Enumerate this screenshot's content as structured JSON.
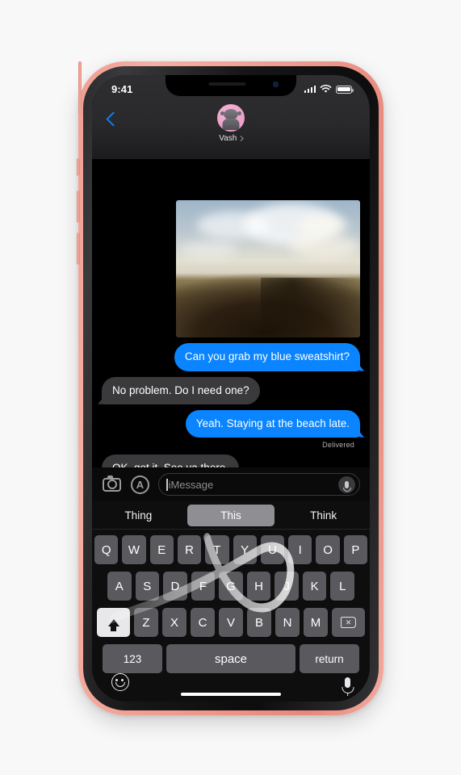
{
  "device": {
    "name": "iPhone XR",
    "frame_color": "#ef9b8f",
    "screen_background": "#000000"
  },
  "status_bar": {
    "time": "9:41",
    "signal_icon": "cellular-bars-icon",
    "wifi_icon": "wifi-icon",
    "battery_icon": "battery-full-icon"
  },
  "nav_bar": {
    "back_icon": "back-chevron-icon",
    "avatar_icon": "memoji-avatar",
    "avatar_background": "#eda3cc",
    "contact_name": "Vash",
    "detail_chevron": "chevron-right-icon"
  },
  "conversation": {
    "attachment": {
      "type": "photo",
      "description": "sand dune landscape at dusk"
    },
    "messages": [
      {
        "text": "Can you grab my blue sweatshirt?",
        "side": "out"
      },
      {
        "text": "No problem. Do I need one?",
        "side": "in"
      },
      {
        "text": "Yeah. Staying at the beach late.",
        "side": "out"
      },
      {
        "text": "OK, got it. See ya there.",
        "side": "in"
      }
    ],
    "delivery_status": "Delivered",
    "outgoing_color": "#0a84ff",
    "incoming_color": "#3a3a3c"
  },
  "input_bar": {
    "camera_icon": "camera-icon",
    "app_store_icon": "app-store-icon",
    "placeholder": "iMessage",
    "value": "",
    "mic_icon": "microphone-icon"
  },
  "keyboard": {
    "predictions": [
      {
        "label": "Thing",
        "selected": false
      },
      {
        "label": "This",
        "selected": true
      },
      {
        "label": "Think",
        "selected": false
      }
    ],
    "row1": [
      "Q",
      "W",
      "E",
      "R",
      "T",
      "Y",
      "U",
      "I",
      "O",
      "P"
    ],
    "row2": [
      "A",
      "S",
      "D",
      "F",
      "G",
      "H",
      "J",
      "K",
      "L"
    ],
    "row3": [
      "Z",
      "X",
      "C",
      "V",
      "B",
      "N",
      "M"
    ],
    "shift_icon": "shift-arrow-icon",
    "shift_active": true,
    "delete_icon": "delete-backspace-icon",
    "numbers_key": "123",
    "space_key": "space",
    "return_key": "return",
    "swipe_trail": "QuickPath gesture spelling This",
    "emoji_icon": "emoji-smiley-icon",
    "dictation_icon": "microphone-icon",
    "home_indicator": "home-indicator-bar"
  }
}
